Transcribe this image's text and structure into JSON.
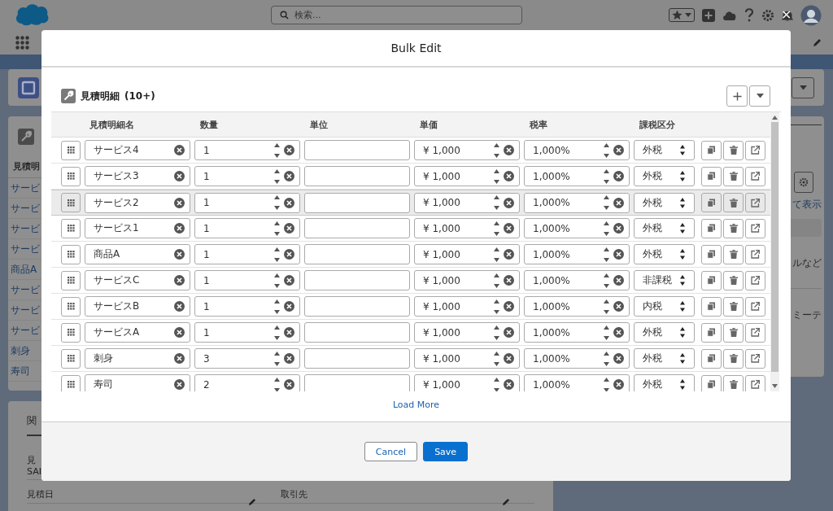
{
  "header": {
    "search": {
      "placeholder": "検索..."
    }
  },
  "background": {
    "left_card": {
      "list_header": "見積明",
      "items": [
        "サービ",
        "サービ",
        "サービ",
        "サービ",
        "商品A",
        "サービ",
        "サービ",
        "サービ",
        "刺身",
        "寿司"
      ]
    },
    "right_card": {
      "texts": [
        {
          "text": "て表示",
          "kind": "link"
        },
        {
          "text": "ルなど",
          "kind": "text"
        },
        {
          "text": "ミーテ",
          "kind": "text"
        }
      ]
    },
    "bottom_card": {
      "tab": "関",
      "fields": [
        {
          "label": "見",
          "value": "SAI"
        },
        {
          "label": "見積日"
        },
        {
          "label": "取引先"
        }
      ]
    }
  },
  "modal": {
    "title": "Bulk Edit",
    "close": "×",
    "section": {
      "title": "見積明細",
      "count": "(10+)"
    },
    "columns": [
      "見積明細名",
      "数量",
      "単位",
      "単価",
      "税率",
      "課税区分"
    ],
    "rows": [
      {
        "name": "サービス4",
        "quantity": "1",
        "price": "¥ 1,000",
        "tax_rate": "1,000%",
        "tax_type": "外税",
        "selected": false
      },
      {
        "name": "サービス3",
        "quantity": "1",
        "price": "¥ 1,000",
        "tax_rate": "1,000%",
        "tax_type": "外税",
        "selected": false
      },
      {
        "name": "サービス2",
        "quantity": "1",
        "price": "¥ 1,000",
        "tax_rate": "1,000%",
        "tax_type": "外税",
        "selected": true
      },
      {
        "name": "サービス1",
        "quantity": "1",
        "price": "¥ 1,000",
        "tax_rate": "1,000%",
        "tax_type": "外税",
        "selected": false
      },
      {
        "name": "商品A",
        "quantity": "1",
        "price": "¥ 1,000",
        "tax_rate": "1,000%",
        "tax_type": "外税",
        "selected": false
      },
      {
        "name": "サービスC",
        "quantity": "1",
        "price": "¥ 1,000",
        "tax_rate": "1,000%",
        "tax_type": "非課税",
        "selected": false
      },
      {
        "name": "サービスB",
        "quantity": "1",
        "price": "¥ 1,000",
        "tax_rate": "1,000%",
        "tax_type": "内税",
        "selected": false
      },
      {
        "name": "サービスA",
        "quantity": "1",
        "price": "¥ 1,000",
        "tax_rate": "1,000%",
        "tax_type": "外税",
        "selected": false
      },
      {
        "name": "刺身",
        "quantity": "3",
        "price": "¥ 1,000",
        "tax_rate": "1,000%",
        "tax_type": "外税",
        "selected": false
      },
      {
        "name": "寿司",
        "quantity": "2",
        "price": "¥ 1,000",
        "tax_rate": "1,000%",
        "tax_type": "外税",
        "selected": false
      }
    ],
    "load_more": "Load More",
    "buttons": [
      {
        "label": "Cancel",
        "kind": "neutral"
      },
      {
        "label": "Save",
        "kind": "brand"
      }
    ]
  }
}
